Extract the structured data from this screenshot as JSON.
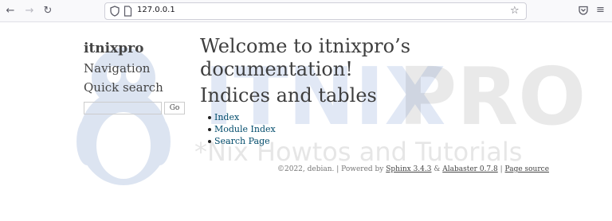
{
  "browser": {
    "url": "127.0.0.1",
    "icons": [
      "back-arrow-icon",
      "forward-arrow-icon",
      "reload-icon",
      "shield-icon",
      "page-icon",
      "star-icon",
      "pocket-icon",
      "hamburger-menu-icon"
    ]
  },
  "watermark": {
    "brand_prefix": "ITNIX",
    "brand_suffix": "PRO",
    "tagline": "*Nix Howtos and Tutorials",
    "brand_color": "#4a78c8"
  },
  "sidebar": {
    "logo": "itnixpro",
    "navigation_heading": "Navigation",
    "quick_search_heading": "Quick search",
    "search_value": "",
    "go_button": "Go"
  },
  "main": {
    "title_line1": "Welcome to itnixpro’s",
    "title_line2": "documentation!",
    "section_heading": "Indices and tables",
    "links": [
      "Index",
      "Module Index",
      "Search Page"
    ],
    "link_color": "#004b6b"
  },
  "footer": {
    "copyright": "©2022, debian. | Powered by",
    "sphinx": "Sphinx 3.4.3",
    "amp": "&",
    "alabaster": "Alabaster 0.7.8",
    "sep": "|",
    "page_source": "Page source"
  }
}
